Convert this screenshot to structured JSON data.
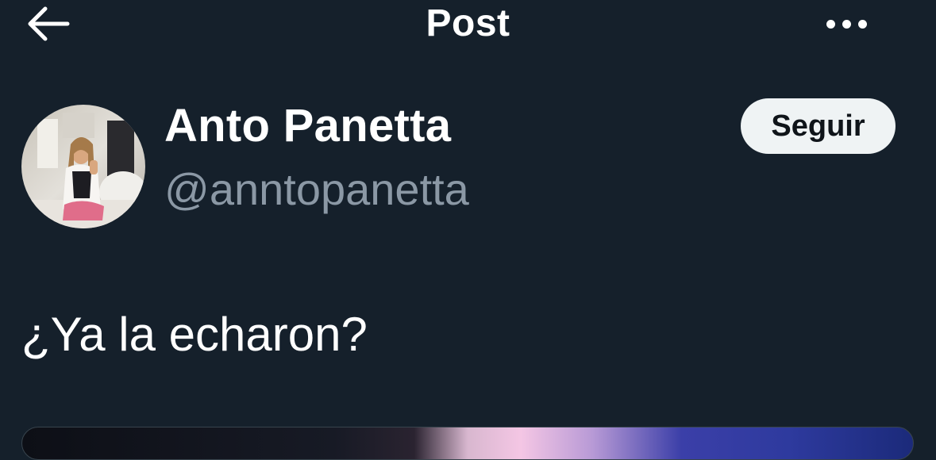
{
  "header": {
    "title": "Post",
    "back_icon": "arrow-left-icon",
    "more_icon": "more-horizontal-icon"
  },
  "author": {
    "display_name": "Anto Panetta",
    "handle": "@anntopanetta",
    "avatar_icon": "avatar-photo"
  },
  "follow_button": {
    "label": "Seguir"
  },
  "post": {
    "text": "¿Ya la echaron?"
  },
  "colors": {
    "background": "#15202b",
    "primary_text": "#ffffff",
    "secondary_text": "#8b98a5",
    "button_bg": "#eff3f4",
    "button_text": "#0f1419"
  }
}
